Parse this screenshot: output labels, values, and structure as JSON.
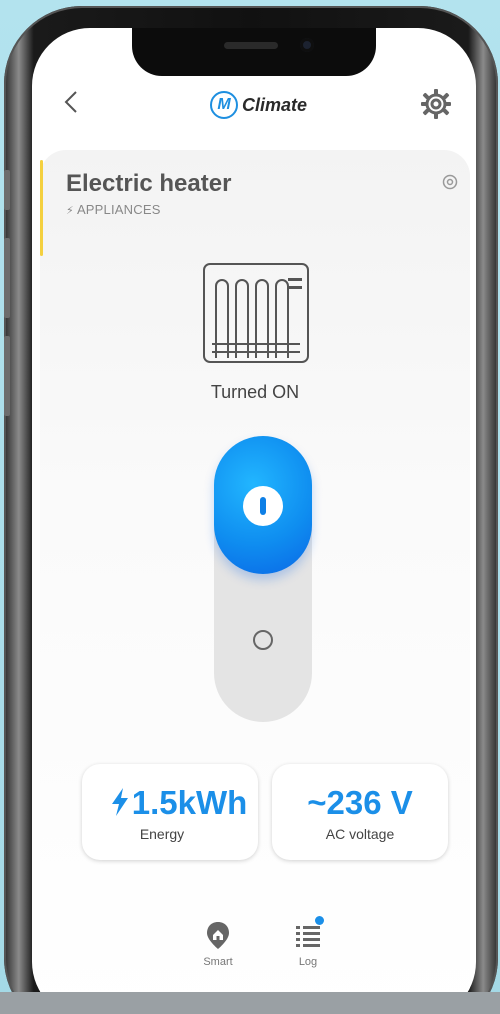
{
  "header": {
    "back_label": "<",
    "logo_mark": "M",
    "app_name": "Climate",
    "settings_icon": "gear-icon"
  },
  "device": {
    "name": "Electric heater",
    "category": "APPLIANCES",
    "category_icon": "plug-icon",
    "icon": "heater-icon",
    "status": "Turned ON",
    "power_on": true
  },
  "stats": {
    "energy": {
      "value": "1.5kWh",
      "prefix": "ϟ",
      "label": "Energy"
    },
    "voltage": {
      "value": "236 V",
      "prefix": "~",
      "label": "AC voltage"
    }
  },
  "nav": {
    "items": [
      {
        "label": "Smart",
        "icon": "map-pin-home-icon"
      },
      {
        "label": "Log",
        "icon": "list-icon",
        "has_notification": true
      }
    ]
  },
  "colors": {
    "accent": "#1b8fe8",
    "knob_top": "#22b6ff",
    "knob_bottom": "#0a67e6",
    "card_marker": "#f4d03f"
  }
}
